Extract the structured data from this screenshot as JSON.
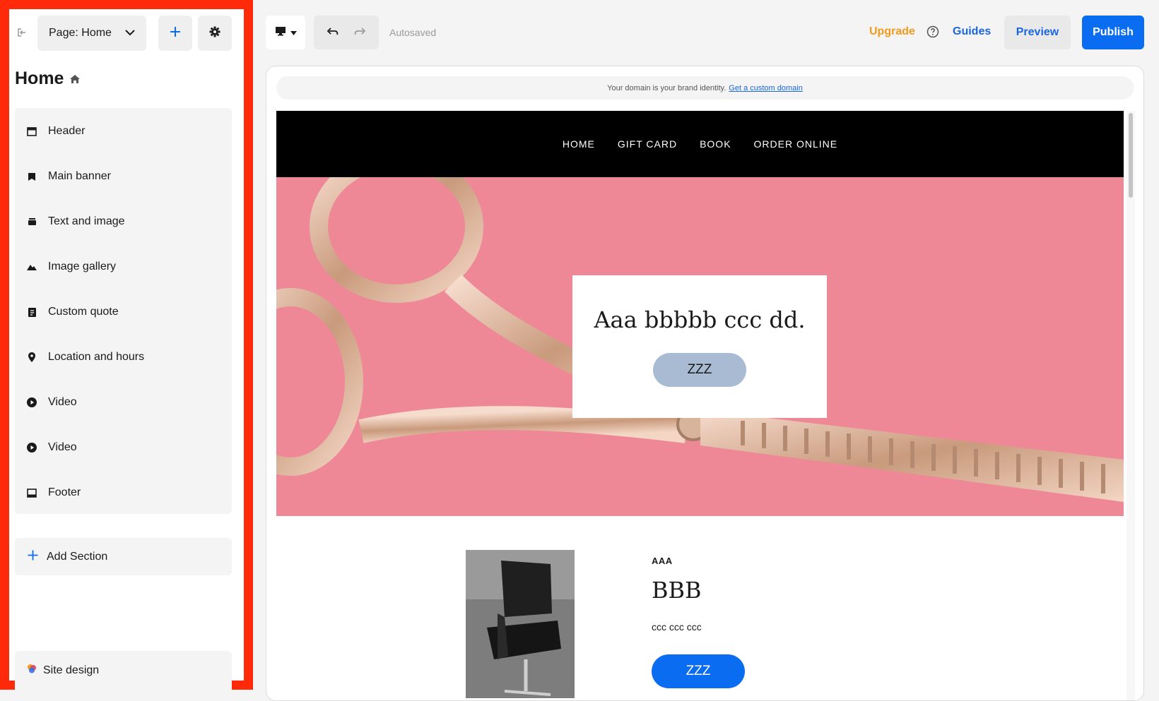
{
  "left_panel": {
    "page_select_label": "Page: Home",
    "home_title": "Home",
    "sections": [
      {
        "label": "Header",
        "icon": "header-icon"
      },
      {
        "label": "Main banner",
        "icon": "bookmark-icon"
      },
      {
        "label": "Text and image",
        "icon": "text-image-icon"
      },
      {
        "label": "Image gallery",
        "icon": "mountain-icon"
      },
      {
        "label": "Custom quote",
        "icon": "quote-icon"
      },
      {
        "label": "Location and hours",
        "icon": "location-pin-icon"
      },
      {
        "label": "Video",
        "icon": "play-icon"
      },
      {
        "label": "Video",
        "icon": "play-icon"
      },
      {
        "label": "Footer",
        "icon": "footer-icon"
      }
    ],
    "add_section_label": "Add Section",
    "site_design_label": "Site design"
  },
  "topbar": {
    "autosaved": "Autosaved",
    "upgrade": "Upgrade",
    "guides": "Guides",
    "preview": "Preview",
    "publish": "Publish"
  },
  "domain_banner": {
    "text": "Your domain is your brand identity.",
    "link": "Get a custom domain"
  },
  "site": {
    "nav": [
      "HOME",
      "GIFT CARD",
      "BOOK",
      "ORDER ONLINE"
    ],
    "hero_heading": "Aaa bbbbb ccc dd.",
    "hero_button": "ZZZ",
    "feature": {
      "eyebrow": "AAA",
      "title": "BBB",
      "body": "ccc ccc ccc",
      "button": "ZZZ"
    }
  },
  "colors": {
    "highlight_border": "#ff2a0a",
    "primary": "#0a6cf0",
    "upgrade": "#f29a1d",
    "hero_bg": "#ef8896",
    "hero_button": "#a9bad3"
  }
}
